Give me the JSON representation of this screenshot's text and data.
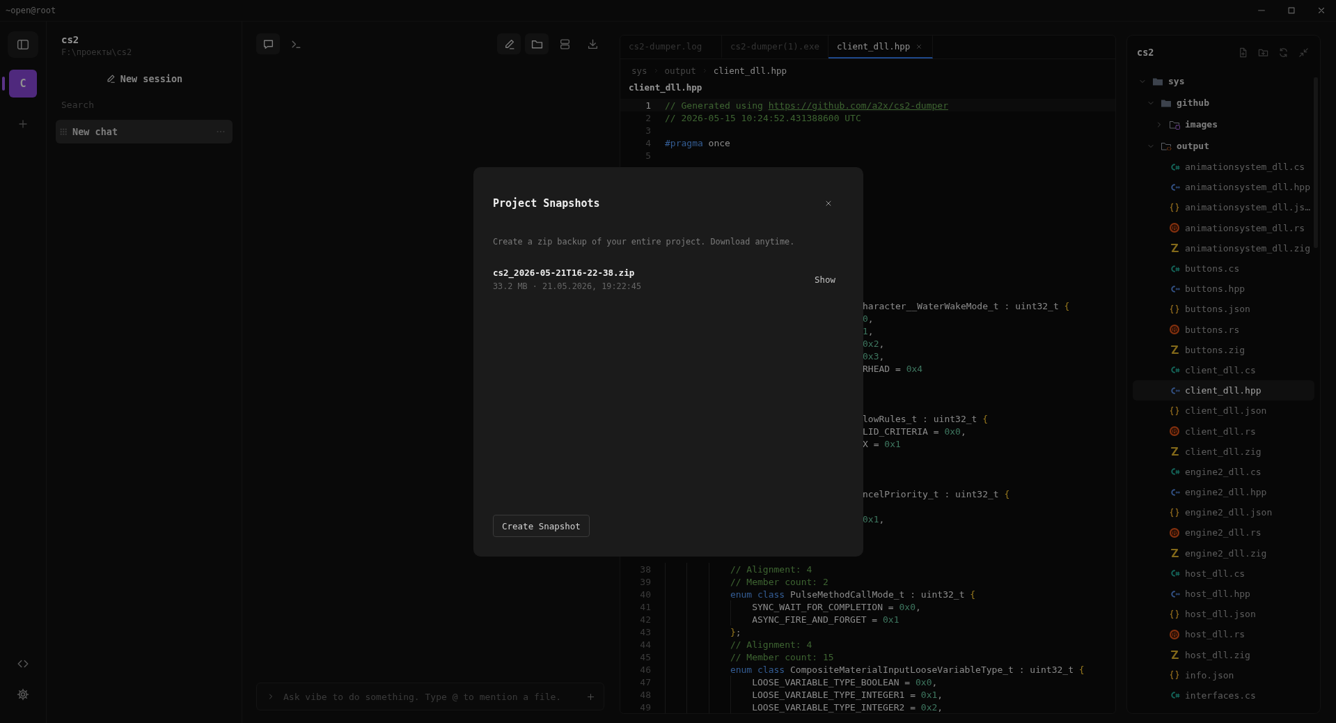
{
  "titlebar": {
    "title": "~open@root"
  },
  "rail": {
    "projects": [
      {
        "initial": "C",
        "selected": true
      }
    ]
  },
  "project": {
    "name": "cs2",
    "path": "F:\\проекты\\cs2",
    "new_session": "New session",
    "search": {
      "placeholder": "Search"
    },
    "sessions": [
      {
        "title": "New chat",
        "selected": true
      }
    ]
  },
  "chat": {
    "modes": [
      {
        "kind": "chat",
        "selected": true
      },
      {
        "kind": "terminal",
        "selected": false
      }
    ],
    "tools": [
      {
        "kind": "edit",
        "active": true
      },
      {
        "kind": "folder",
        "active": true
      },
      {
        "kind": "layout",
        "active": false
      },
      {
        "kind": "download",
        "active": false
      }
    ],
    "input": {
      "placeholder": "Ask vibe to do something. Type @ to mention a file."
    }
  },
  "editor": {
    "tabs": [
      {
        "label": "cs2-dumper.log",
        "selected": false,
        "closable": false
      },
      {
        "label": "cs2-dumper(1).exe",
        "selected": false,
        "closable": false
      },
      {
        "label": "client_dll.hpp",
        "selected": true,
        "closable": true
      }
    ],
    "breadcrumb": [
      "sys",
      "output",
      "client_dll.hpp"
    ],
    "file_title": "client_dll.hpp",
    "lines": [
      {
        "kind": "code",
        "number": "1",
        "current": true,
        "tokens": [
          {
            "kind": "comment",
            "t": "// Generated using "
          },
          {
            "kind": "link",
            "t": "https://github.com/a2x/cs2-dumper"
          }
        ]
      },
      {
        "kind": "code",
        "number": "2",
        "current": false,
        "tokens": [
          {
            "kind": "comment",
            "t": "// 2026-05-15 10:24:52.431388600 UTC"
          }
        ]
      },
      {
        "kind": "code",
        "number": "3",
        "current": false
      },
      {
        "kind": "code",
        "number": "4",
        "current": false,
        "tokens": [
          {
            "kind": "keyword",
            "t": "#pragma"
          },
          {
            "kind": "plain",
            "t": " once"
          }
        ]
      },
      {
        "kind": "code",
        "number": "5",
        "current": false
      },
      {
        "kind": "hidden"
      },
      {
        "kind": "hidden"
      },
      {
        "kind": "hidden"
      },
      {
        "kind": "hidden"
      },
      {
        "kind": "hidden"
      },
      {
        "kind": "hidden"
      },
      {
        "kind": "hidden"
      },
      {
        "kind": "hidden"
      },
      {
        "kind": "hidden"
      },
      {
        "kind": "hidden"
      },
      {
        "kind": "hidden"
      },
      {
        "kind": "partial",
        "tokens": [
          {
            "kind": "plain",
            "t": "haracter__WaterWakeMode_t : uint32_t "
          },
          {
            "kind": "brace",
            "t": "{"
          }
        ]
      },
      {
        "kind": "partial",
        "tokens": [
          {
            "kind": "number",
            "t": "0"
          },
          {
            "kind": "plain",
            "t": ","
          }
        ]
      },
      {
        "kind": "partial",
        "tokens": [
          {
            "kind": "number",
            "t": "1"
          },
          {
            "kind": "plain",
            "t": ","
          }
        ]
      },
      {
        "kind": "partial",
        "tokens": [
          {
            "kind": "number",
            "t": "0x2"
          },
          {
            "kind": "plain",
            "t": ","
          }
        ]
      },
      {
        "kind": "partial",
        "tokens": [
          {
            "kind": "number",
            "t": "0x3"
          },
          {
            "kind": "plain",
            "t": ","
          }
        ]
      },
      {
        "kind": "partial",
        "tokens": [
          {
            "kind": "plain",
            "t": "RHEAD = "
          },
          {
            "kind": "number",
            "t": "0x4"
          }
        ]
      },
      {
        "kind": "hidden"
      },
      {
        "kind": "hidden"
      },
      {
        "kind": "hidden"
      },
      {
        "kind": "partial",
        "tokens": [
          {
            "kind": "plain",
            "t": "lowRules_t : uint32_t "
          },
          {
            "kind": "brace",
            "t": "{"
          }
        ]
      },
      {
        "kind": "partial",
        "tokens": [
          {
            "kind": "plain",
            "t": "LID_CRITERIA = "
          },
          {
            "kind": "number",
            "t": "0x0"
          },
          {
            "kind": "plain",
            "t": ","
          }
        ]
      },
      {
        "kind": "partial",
        "tokens": [
          {
            "kind": "plain",
            "t": "X = "
          },
          {
            "kind": "number",
            "t": "0x1"
          }
        ]
      },
      {
        "kind": "hidden"
      },
      {
        "kind": "hidden"
      },
      {
        "kind": "hidden"
      },
      {
        "kind": "partial",
        "tokens": [
          {
            "kind": "plain",
            "t": "ncelPriority_t : uint32_t "
          },
          {
            "kind": "brace",
            "t": "{"
          }
        ]
      },
      {
        "kind": "hidden"
      },
      {
        "kind": "partial",
        "tokens": [
          {
            "kind": "number",
            "t": "0x1"
          },
          {
            "kind": "plain",
            "t": ","
          }
        ]
      },
      {
        "kind": "hidden"
      },
      {
        "kind": "hidden"
      },
      {
        "kind": "hidden"
      },
      {
        "kind": "block",
        "children": [
          {
            "kind": "block",
            "children": [
              {
                "kind": "block",
                "children": [
                  {
                    "kind": "code",
                    "number": "38",
                    "current": false,
                    "tokens": [
                      {
                        "kind": "comment",
                        "t": "// Alignment: 4"
                      }
                    ]
                  },
                  {
                    "kind": "code",
                    "number": "39",
                    "current": false,
                    "tokens": [
                      {
                        "kind": "comment",
                        "t": "// Member count: 2"
                      }
                    ]
                  },
                  {
                    "kind": "code",
                    "number": "40",
                    "current": false,
                    "tokens": [
                      {
                        "kind": "keyword",
                        "t": "enum class"
                      },
                      {
                        "kind": "plain",
                        "t": " PulseMethodCallMode_t : uint32_t "
                      },
                      {
                        "kind": "brace",
                        "t": "{"
                      }
                    ]
                  },
                  {
                    "kind": "block",
                    "children": [
                      {
                        "kind": "code",
                        "number": "41",
                        "current": false,
                        "tokens": [
                          {
                            "kind": "plain",
                            "t": "SYNC_WAIT_FOR_COMPLETION = "
                          },
                          {
                            "kind": "number",
                            "t": "0x0"
                          },
                          {
                            "kind": "plain",
                            "t": ","
                          }
                        ]
                      },
                      {
                        "kind": "code",
                        "number": "42",
                        "current": false,
                        "tokens": [
                          {
                            "kind": "plain",
                            "t": "ASYNC_FIRE_AND_FORGET = "
                          },
                          {
                            "kind": "number",
                            "t": "0x1"
                          }
                        ]
                      }
                    ]
                  },
                  {
                    "kind": "code",
                    "number": "43",
                    "current": false,
                    "tokens": [
                      {
                        "kind": "brace",
                        "t": "}"
                      },
                      {
                        "kind": "plain",
                        "t": ";"
                      }
                    ]
                  },
                  {
                    "kind": "code",
                    "number": "44",
                    "current": false,
                    "tokens": [
                      {
                        "kind": "comment",
                        "t": "// Alignment: 4"
                      }
                    ]
                  },
                  {
                    "kind": "code",
                    "number": "45",
                    "current": false,
                    "tokens": [
                      {
                        "kind": "comment",
                        "t": "// Member count: 15"
                      }
                    ]
                  },
                  {
                    "kind": "code",
                    "number": "46",
                    "current": false,
                    "tokens": [
                      {
                        "kind": "keyword",
                        "t": "enum class"
                      },
                      {
                        "kind": "plain",
                        "t": " CompositeMaterialInputLooseVariableType_t : uint32_t "
                      },
                      {
                        "kind": "brace",
                        "t": "{"
                      }
                    ]
                  },
                  {
                    "kind": "block",
                    "children": [
                      {
                        "kind": "code",
                        "number": "47",
                        "current": false,
                        "tokens": [
                          {
                            "kind": "plain",
                            "t": "LOOSE_VARIABLE_TYPE_BOOLEAN = "
                          },
                          {
                            "kind": "number",
                            "t": "0x0"
                          },
                          {
                            "kind": "plain",
                            "t": ","
                          }
                        ]
                      },
                      {
                        "kind": "code",
                        "number": "48",
                        "current": false,
                        "tokens": [
                          {
                            "kind": "plain",
                            "t": "LOOSE_VARIABLE_TYPE_INTEGER1 = "
                          },
                          {
                            "kind": "number",
                            "t": "0x1"
                          },
                          {
                            "kind": "plain",
                            "t": ","
                          }
                        ]
                      },
                      {
                        "kind": "code",
                        "number": "49",
                        "current": false,
                        "tokens": [
                          {
                            "kind": "plain",
                            "t": "LOOSE_VARIABLE_TYPE_INTEGER2 = "
                          },
                          {
                            "kind": "number",
                            "t": "0x2"
                          },
                          {
                            "kind": "plain",
                            "t": ","
                          }
                        ]
                      }
                    ]
                  }
                ]
              }
            ]
          }
        ]
      }
    ]
  },
  "file_tree": {
    "title": "cs2",
    "items": [
      {
        "label": "sys",
        "kind": "folder",
        "expanded": true,
        "selected": false,
        "children": [
          {
            "label": "github",
            "kind": "folder",
            "expanded": true,
            "selected": false,
            "children": [
              {
                "label": "images",
                "kind": "image-folder",
                "expanded": false,
                "selected": false
              }
            ]
          },
          {
            "label": "output",
            "kind": "code-folder",
            "expanded": true,
            "selected": false,
            "children": [
              {
                "label": "animationsystem_dll.cs",
                "kind": "cs",
                "selected": false
              },
              {
                "label": "animationsystem_dll.hpp",
                "kind": "hpp",
                "selected": false
              },
              {
                "label": "animationsystem_dll.js…",
                "kind": "json",
                "selected": false
              },
              {
                "label": "animationsystem_dll.rs",
                "kind": "rs",
                "selected": false
              },
              {
                "label": "animationsystem_dll.zig",
                "kind": "zig",
                "selected": false
              },
              {
                "label": "buttons.cs",
                "kind": "cs",
                "selected": false
              },
              {
                "label": "buttons.hpp",
                "kind": "hpp",
                "selected": false
              },
              {
                "label": "buttons.json",
                "kind": "json",
                "selected": false
              },
              {
                "label": "buttons.rs",
                "kind": "rs",
                "selected": false
              },
              {
                "label": "buttons.zig",
                "kind": "zig",
                "selected": false
              },
              {
                "label": "client_dll.cs",
                "kind": "cs",
                "selected": false
              },
              {
                "label": "client_dll.hpp",
                "kind": "hpp",
                "selected": true
              },
              {
                "label": "client_dll.json",
                "kind": "json",
                "selected": false
              },
              {
                "label": "client_dll.rs",
                "kind": "rs",
                "selected": false
              },
              {
                "label": "client_dll.zig",
                "kind": "zig",
                "selected": false
              },
              {
                "label": "engine2_dll.cs",
                "kind": "cs",
                "selected": false
              },
              {
                "label": "engine2_dll.hpp",
                "kind": "hpp",
                "selected": false
              },
              {
                "label": "engine2_dll.json",
                "kind": "json",
                "selected": false
              },
              {
                "label": "engine2_dll.rs",
                "kind": "rs",
                "selected": false
              },
              {
                "label": "engine2_dll.zig",
                "kind": "zig",
                "selected": false
              },
              {
                "label": "host_dll.cs",
                "kind": "cs",
                "selected": false
              },
              {
                "label": "host_dll.hpp",
                "kind": "hpp",
                "selected": false
              },
              {
                "label": "host_dll.json",
                "kind": "json",
                "selected": false
              },
              {
                "label": "host_dll.rs",
                "kind": "rs",
                "selected": false
              },
              {
                "label": "host_dll.zig",
                "kind": "zig",
                "selected": false
              },
              {
                "label": "info.json",
                "kind": "json",
                "selected": false
              },
              {
                "label": "interfaces.cs",
                "kind": "cs",
                "selected": false
              }
            ]
          }
        ]
      }
    ]
  },
  "modal": {
    "title": "Project Snapshots",
    "description": "Create a zip backup of your entire project. Download anytime.",
    "snapshots": [
      {
        "name": "cs2_2026-05-21T16-22-38.zip",
        "meta": "33.2 MB · 21.05.2026, 19:22:45",
        "action": "Show"
      }
    ],
    "create_button": "Create Snapshot"
  }
}
